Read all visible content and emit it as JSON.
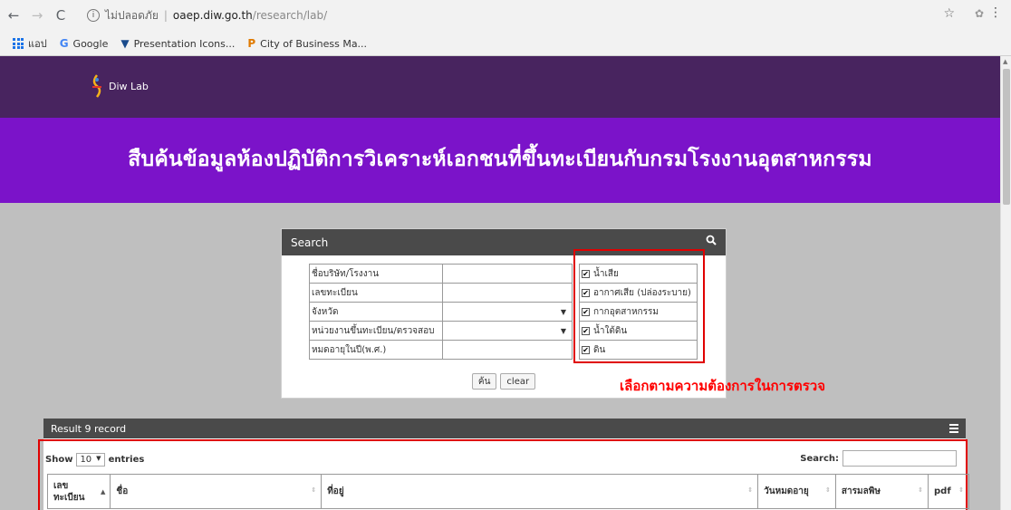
{
  "browser": {
    "insecure_label": "ไม่ปลอดภัย",
    "host": "oaep.diw.go.th",
    "path": "/research/lab/",
    "bookmarks": [
      {
        "label": "แอป"
      },
      {
        "label": "Google"
      },
      {
        "label": "Presentation Icons..."
      },
      {
        "label": "City of Business Ma..."
      }
    ]
  },
  "site": {
    "logo_text": "Diw Lab",
    "banner_title": "สืบค้นข้อมูลห้องปฏิบัติการวิเคราะห์เอกชนที่ขึ้นทะเบียนกับกรมโรงงานอุตสาหกรรม"
  },
  "search": {
    "title": "Search",
    "fields": [
      {
        "label": "ชื่อบริษัท/โรงงาน",
        "value": ""
      },
      {
        "label": "เลขทะเบียน",
        "value": ""
      },
      {
        "label": "จังหวัด",
        "value": ""
      },
      {
        "label": "หน่วยงานขึ้นทะเบียน/ตรวจสอบ",
        "value": ""
      },
      {
        "label": "หมดอายุในปี(พ.ศ.)",
        "value": ""
      }
    ],
    "options": [
      {
        "label": "น้ำเสีย",
        "checked": true
      },
      {
        "label": "อากาศเสีย (ปล่องระบาย)",
        "checked": true
      },
      {
        "label": "กากอุตสาหกรรม",
        "checked": true
      },
      {
        "label": "น้ำใต้ดิน",
        "checked": true
      },
      {
        "label": "ดิน",
        "checked": true
      }
    ],
    "search_button": "ค้น",
    "clear_button": "clear",
    "annotation": "เลือกตามความต้องการในการตรวจ"
  },
  "result": {
    "title": "Result 9 record",
    "show_label": "Show",
    "entries_value": "10",
    "entries_label": "entries",
    "search_label": "Search:",
    "search_value": "",
    "columns": [
      "เลข\nทะเบียน",
      "ชื่อ",
      "ที่อยู่",
      "วันหมดอายุ",
      "สารมลพิษ",
      "pdf"
    ]
  },
  "colors": {
    "header_bg": "#48245f",
    "banner_bg": "#7b13c9",
    "panel_head": "#4a4a4a",
    "highlight": "#e00000"
  }
}
